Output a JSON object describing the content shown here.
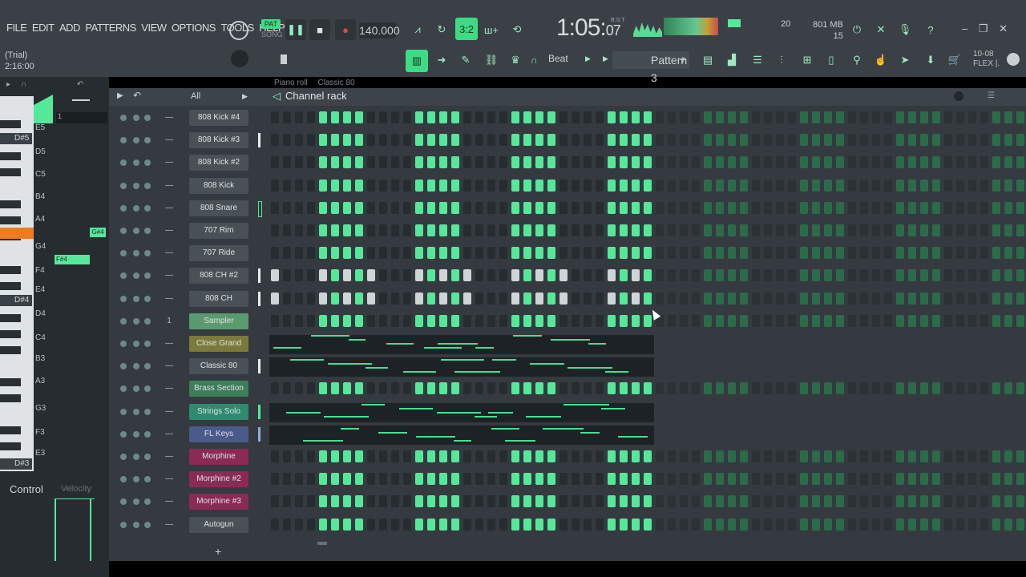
{
  "menu": [
    "FILE",
    "EDIT",
    "ADD",
    "PATTERNS",
    "VIEW",
    "OPTIONS",
    "TOOLS",
    "HELP"
  ],
  "hint": {
    "trial": "(Trial)",
    "time": "2:16:00"
  },
  "transport": {
    "pat_label": "PAT",
    "song_label": "SONG",
    "tempo": "140.000",
    "clock_main": "1:05",
    "clock_sub": "07",
    "clock_tag": "B:S:T"
  },
  "status": {
    "cpu": "20",
    "memory": "801 MB",
    "polyphony": "15"
  },
  "toolbar": {
    "snap": "Beat",
    "pattern": "Pattern 3",
    "pattern_add": "+",
    "flex_date": "10-08",
    "flex_label": "FLEX |."
  },
  "piano": {
    "octave_labels": [
      "D#5",
      "D#4",
      "D#3"
    ],
    "note_labels": [
      "E5",
      "D5",
      "C5",
      "B4",
      "A4",
      "G4",
      "F4",
      "E4",
      "D4",
      "C4",
      "B3",
      "A3",
      "G3",
      "F3",
      "E3"
    ],
    "note_tags": [
      "G#4",
      "F#4"
    ],
    "control": "Control",
    "velocity": "Velocity"
  },
  "rack": {
    "title": "Channel rack",
    "filter": "All",
    "header_tabs": [
      "Piano roll",
      "Classic 80"
    ],
    "sampler_route": "1",
    "add_channel": "+",
    "channels": [
      {
        "name": "808 Kick #4",
        "color": "#4a5156",
        "pattern": "k"
      },
      {
        "name": "808 Kick #3",
        "color": "#4a5156",
        "pattern": "k"
      },
      {
        "name": "808 Kick #2",
        "color": "#4a5156",
        "pattern": "k"
      },
      {
        "name": "808 Kick",
        "color": "#4a5156",
        "pattern": "k"
      },
      {
        "name": "808 Snare",
        "color": "#4a5156",
        "pattern": "k"
      },
      {
        "name": "707 Rim",
        "color": "#4a5156",
        "pattern": "k"
      },
      {
        "name": "707 Ride",
        "color": "#4a5156",
        "pattern": "k"
      },
      {
        "name": "808 CH #2",
        "color": "#4a5156",
        "pattern": "w"
      },
      {
        "name": "808 CH",
        "color": "#4a5156",
        "pattern": "w"
      },
      {
        "name": "Sampler",
        "color": "#5a9a6e",
        "pattern": "k"
      },
      {
        "name": "Close Grand",
        "color": "#7a7a3a",
        "pattern": "roll"
      },
      {
        "name": "Classic 80",
        "color": "#4a5156",
        "pattern": "roll"
      },
      {
        "name": "Brass Section",
        "color": "#3c7e5a",
        "pattern": "k"
      },
      {
        "name": "Strings Solo",
        "color": "#2f8a70",
        "pattern": "roll"
      },
      {
        "name": "FL Keys",
        "color": "#4a5a8a",
        "pattern": "roll"
      },
      {
        "name": "Morphine",
        "color": "#8a2a55",
        "pattern": "k"
      },
      {
        "name": "Morphine #2",
        "color": "#8a2a55",
        "pattern": "k"
      },
      {
        "name": "Morphine #3",
        "color": "#8a2a55",
        "pattern": "k"
      },
      {
        "name": "Autogun",
        "color": "#4a5156",
        "pattern": "k"
      }
    ]
  }
}
